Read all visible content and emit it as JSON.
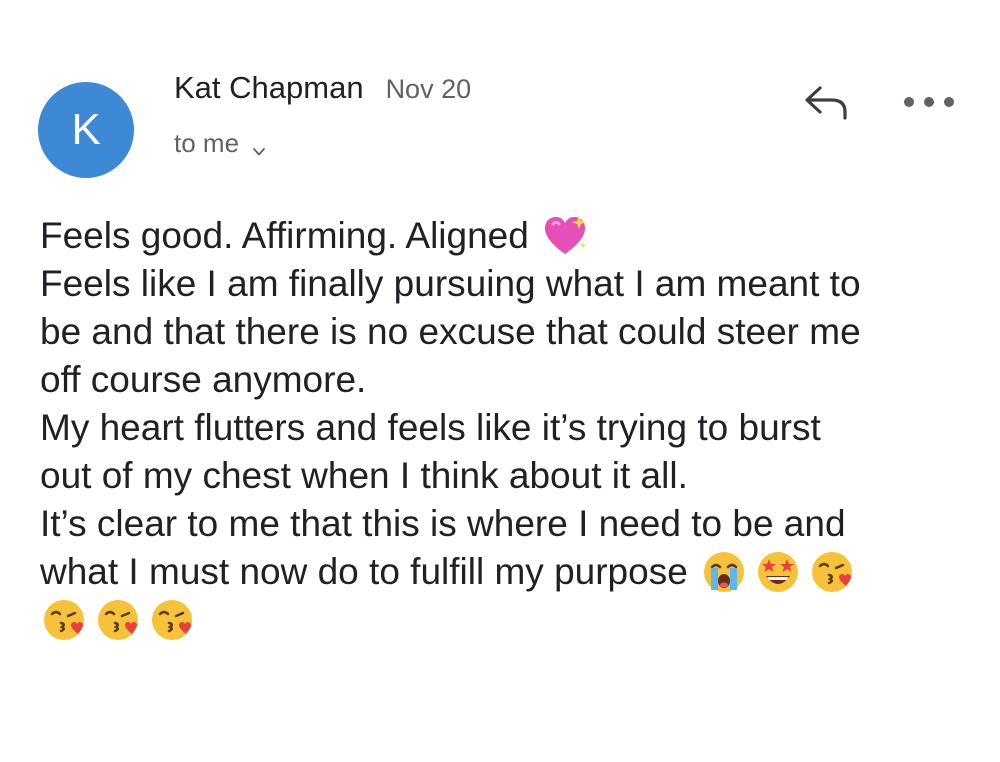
{
  "header": {
    "avatar_letter": "K",
    "sender_name": "Kat Chapman",
    "date": "Nov 20",
    "recipient": "to me"
  },
  "actions": {
    "reply_icon": "reply-icon",
    "more_icon": "more-horizontal-icon"
  },
  "message": {
    "line1": "Feels good. Affirming. Aligned",
    "line2": "Feels like I am finally pursuing what I am meant to",
    "line3": "be and that there is no excuse that could steer me",
    "line4": "off course anymore.",
    "line5": "My heart flutters and feels like it’s trying to burst",
    "line6": "out of my chest when I think about it all.",
    "line7": "It’s clear to me that this is where I need to be and",
    "line8": "what I must now do to fulfill my purpose"
  },
  "emojis": {
    "line1": [
      "sparkling-heart"
    ],
    "line8": [
      "loudly-crying-face",
      "star-struck-face",
      "face-blowing-kiss"
    ],
    "line9": [
      "face-blowing-kiss",
      "face-blowing-kiss",
      "face-blowing-kiss"
    ]
  },
  "colors": {
    "avatar": "#3d89d6",
    "text": "#202124",
    "secondary_text": "#5f6368"
  }
}
